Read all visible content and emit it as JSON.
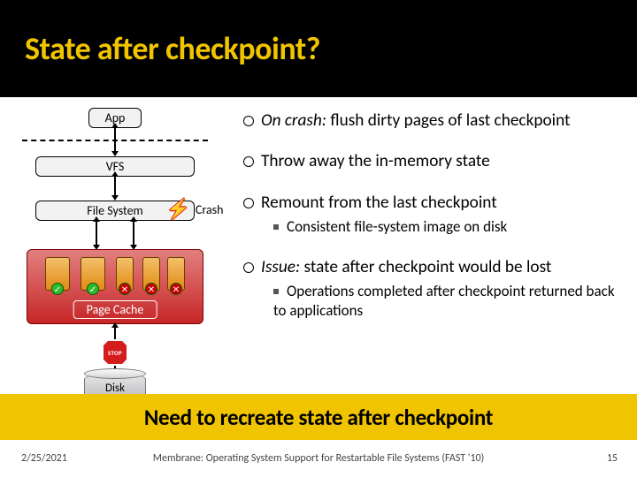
{
  "title": "State after checkpoint?",
  "diagram": {
    "app": "App",
    "vfs": "VFS",
    "fs": "File System",
    "crash_label": "Crash",
    "page_cache": "Page Cache",
    "stop": "STOP",
    "disk": "Disk"
  },
  "bullets": {
    "b1_em": "On crash:",
    "b1_rest": " flush dirty pages of last checkpoint",
    "b2": "Throw away the in-memory state",
    "b3": "Remount from the last checkpoint",
    "b3_sub": "Consistent file-system image on disk",
    "b4_em": "Issue:",
    "b4_rest": " state after checkpoint would be lost",
    "b4_sub": "Operations completed after checkpoint returned back to applications"
  },
  "banner": "Need to recreate state after checkpoint",
  "footer": {
    "date": "2/25/2021",
    "caption": "Membrane: Operating System Support for Restartable File Systems (FAST '10)",
    "page": "15"
  }
}
